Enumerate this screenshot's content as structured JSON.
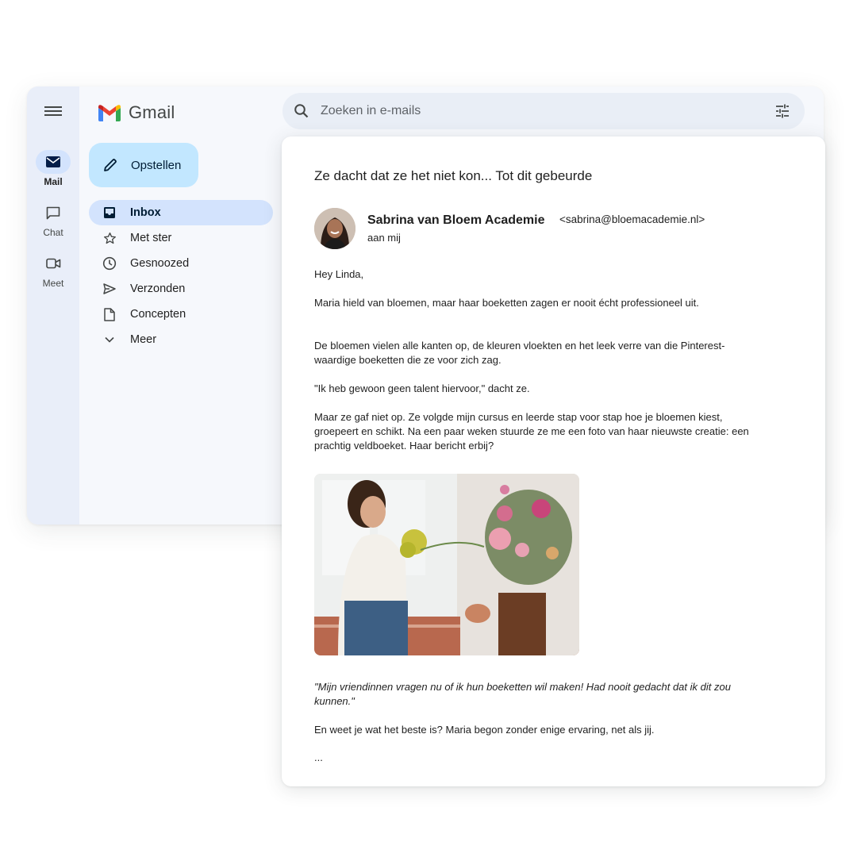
{
  "app": {
    "name": "Gmail"
  },
  "rail": {
    "items": [
      {
        "label": "Mail",
        "icon": "mail-icon"
      },
      {
        "label": "Chat",
        "icon": "chat-icon"
      },
      {
        "label": "Meet",
        "icon": "meet-icon"
      }
    ]
  },
  "compose": {
    "label": "Opstellen"
  },
  "nav": {
    "items": [
      {
        "label": "Inbox",
        "icon": "inbox-icon"
      },
      {
        "label": "Met ster",
        "icon": "star-icon"
      },
      {
        "label": "Gesnoozed",
        "icon": "clock-icon"
      },
      {
        "label": "Verzonden",
        "icon": "send-icon"
      },
      {
        "label": "Concepten",
        "icon": "file-icon"
      },
      {
        "label": "Meer",
        "icon": "chevron-down-icon"
      }
    ]
  },
  "search": {
    "placeholder": "Zoeken in e-mails"
  },
  "email": {
    "subject": "Ze dacht dat ze het niet kon... Tot dit gebeurde",
    "sender_name": "Sabrina van Bloem Academie",
    "sender_email": "<sabrina@bloemacademie.nl>",
    "recipient": "aan mij",
    "greeting": "Hey Linda,",
    "p1": "Maria hield van bloemen, maar haar boeketten zagen er nooit écht professioneel uit.",
    "p2": "De bloemen vielen alle kanten op, de kleuren vloekten en het leek verre van die Pinterest-waardige boeketten die ze voor zich zag.",
    "p3": "\"Ik heb gewoon geen talent hiervoor,\" dacht ze.",
    "p4": "Maar ze gaf niet op. Ze volgde mijn cursus en leerde stap voor stap hoe je bloemen kiest, groepeert en schikt. Na een paar weken stuurde ze me een foto van haar nieuwste creatie: een prachtig veldboeket. Haar bericht erbij?",
    "quote": "\"Mijn vriendinnen vragen nu of ik hun boeketten wil maken! Had nooit gedacht dat ik dit zou kunnen.\"",
    "p5": "En weet je wat het beste is? Maria begon zonder enige ervaring, net als jij.",
    "ellipsis": "..."
  },
  "colors": {
    "accent": "#d3e3fd",
    "compose": "#c2e7ff",
    "rail": "#e9eef9",
    "background": "#f6f8fc"
  }
}
